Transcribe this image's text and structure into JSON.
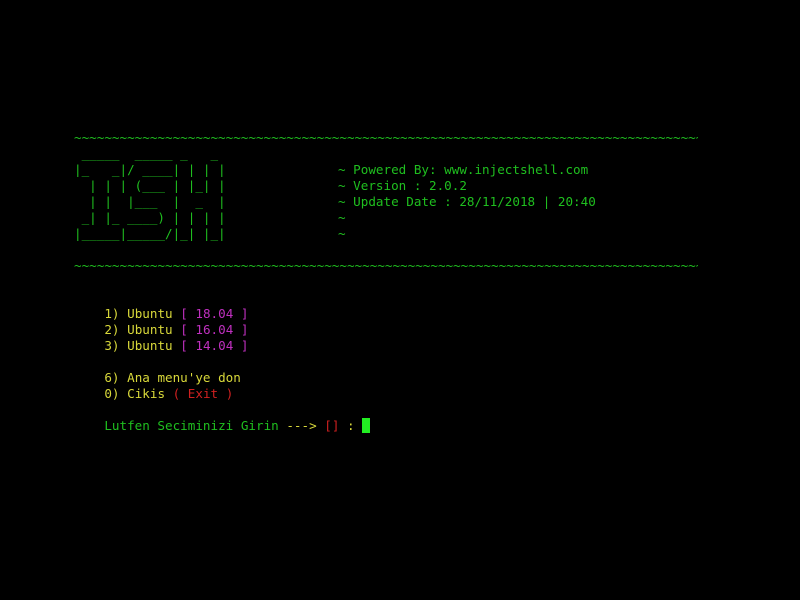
{
  "colors": {
    "background": "#000000",
    "green": "#1fbf1f",
    "yellow": "#d8d83a",
    "magenta": "#c030c0",
    "red": "#d02020",
    "cursor": "#22ee22"
  },
  "separator": "~~~~~~~~~~~~~~~~~~~~~~~~~~~~~~~~~~~~~~~~~~~~~~~~~~~~~~~~~~~~~~~~~~~~~~~~~~~~~~~~~~~~~~~~~~",
  "banner": {
    "logo_lines": [
      " _____  _____ _   _ ",
      "|_   _|/ ____| | | |",
      "  | | | (___ | |_| |",
      "  | |  |___  |  _  |",
      " _| |_ ____) | | | |",
      "|_____|_____/|_| |_|"
    ],
    "info": {
      "powered_by": "~ Powered By: www.injectshell.com",
      "version": "~ Version : 2.0.2",
      "update_date": "~ Update Date : 28/11/2018 | 20:40",
      "blank1": "~",
      "blank2": "~"
    }
  },
  "menu": {
    "items": [
      {
        "number": "1)",
        "label": "Ubuntu",
        "bracket_open": "[",
        "version": "18.04",
        "bracket_close": "]"
      },
      {
        "number": "2)",
        "label": "Ubuntu",
        "bracket_open": "[",
        "version": "16.04",
        "bracket_close": "]"
      },
      {
        "number": "3)",
        "label": "Ubuntu",
        "bracket_open": "[",
        "version": "14.04",
        "bracket_close": "]"
      }
    ],
    "back": {
      "number": "6)",
      "label": "Ana menu'ye don"
    },
    "exit": {
      "number": "0)",
      "label": "Cikis",
      "paren_label": "( Exit )"
    }
  },
  "prompt": {
    "text": "Lutfen Seciminizi Girin",
    "arrow": "--->",
    "brackets": "[]",
    "colon": ":"
  }
}
